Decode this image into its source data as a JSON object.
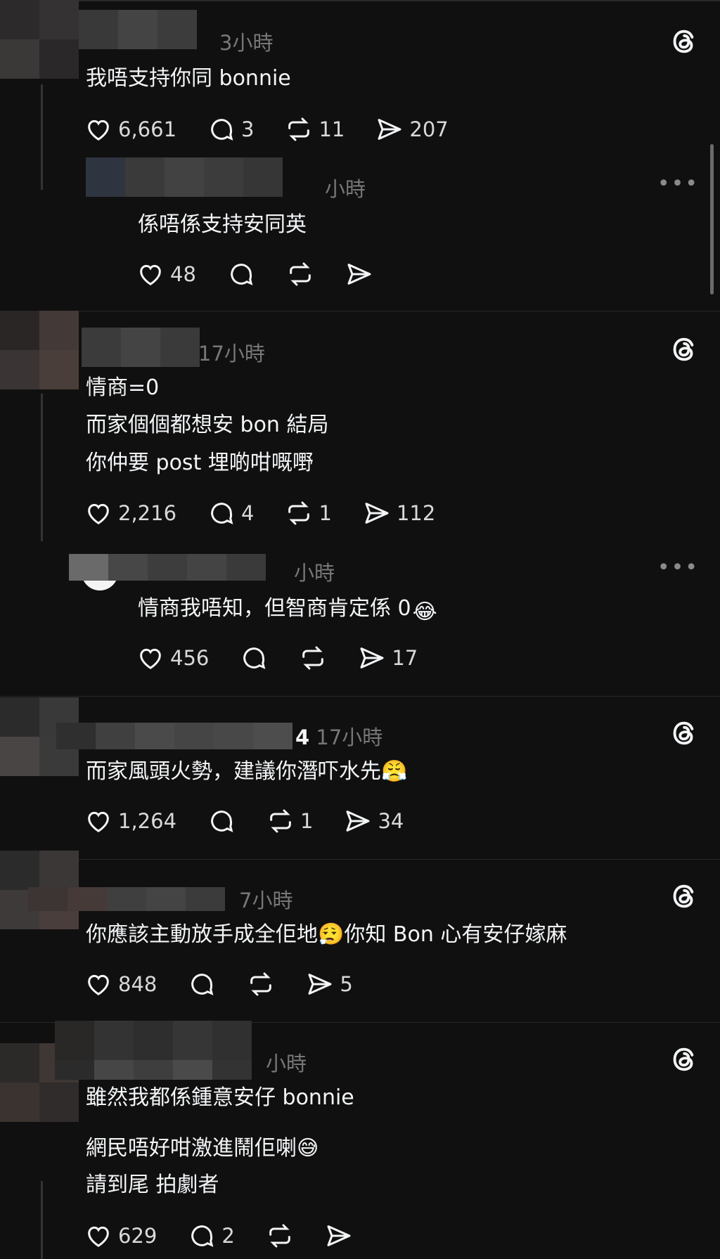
{
  "colors": {
    "background": "#101010",
    "text": "#f3f5f7",
    "muted": "#777777",
    "divider": "#262626"
  },
  "icons": {
    "like": "heart-icon",
    "comment": "comment-bubble-icon",
    "repost": "repost-icon",
    "share": "send-icon",
    "brand": "threads-logo-icon",
    "more": "more-options-icon"
  },
  "posts": [
    {
      "time": "3小時",
      "lines": [
        "我唔支持你同 bonnie"
      ],
      "likes": "6,661",
      "comments": "3",
      "reposts": "11",
      "shares": "207",
      "reply": {
        "time": "小時",
        "text": "係唔係支持安同英",
        "likes": "48",
        "comments": "",
        "reposts": "",
        "shares": ""
      }
    },
    {
      "time": "17小時",
      "lines": [
        "情商=0",
        "而家個個都想安 bon 結局",
        "你仲要 post 埋啲咁嘅嘢"
      ],
      "likes": "2,216",
      "comments": "4",
      "reposts": "1",
      "shares": "112",
      "reply": {
        "time": "小時",
        "text": "情商我唔知，但智商肯定係 0",
        "emoji": "😂",
        "likes": "456",
        "comments": "",
        "reposts": "",
        "shares": "17"
      }
    },
    {
      "handle_suffix": "4",
      "time": "17小時",
      "text": "而家風頭火勢，建議你潛吓水先",
      "emoji": "😤",
      "likes": "1,264",
      "comments": "",
      "reposts": "1",
      "shares": "34"
    },
    {
      "time": "7小時",
      "text_before": "你應該主動放手成全佢地",
      "emoji": "😮‍💨",
      "text_after": "你知 Bon 心有安仔嫁麻",
      "likes": "848",
      "comments": "",
      "reposts": "",
      "shares": "5"
    },
    {
      "time": "小時",
      "line1": "雖然我都係鍾意安仔 bonnie",
      "line2": "網民唔好咁激進鬧佢喇",
      "line2_emoji": "😅",
      "line3": "請到尾 拍劇者",
      "likes": "629",
      "comments": "2",
      "reposts": "",
      "shares": ""
    }
  ]
}
